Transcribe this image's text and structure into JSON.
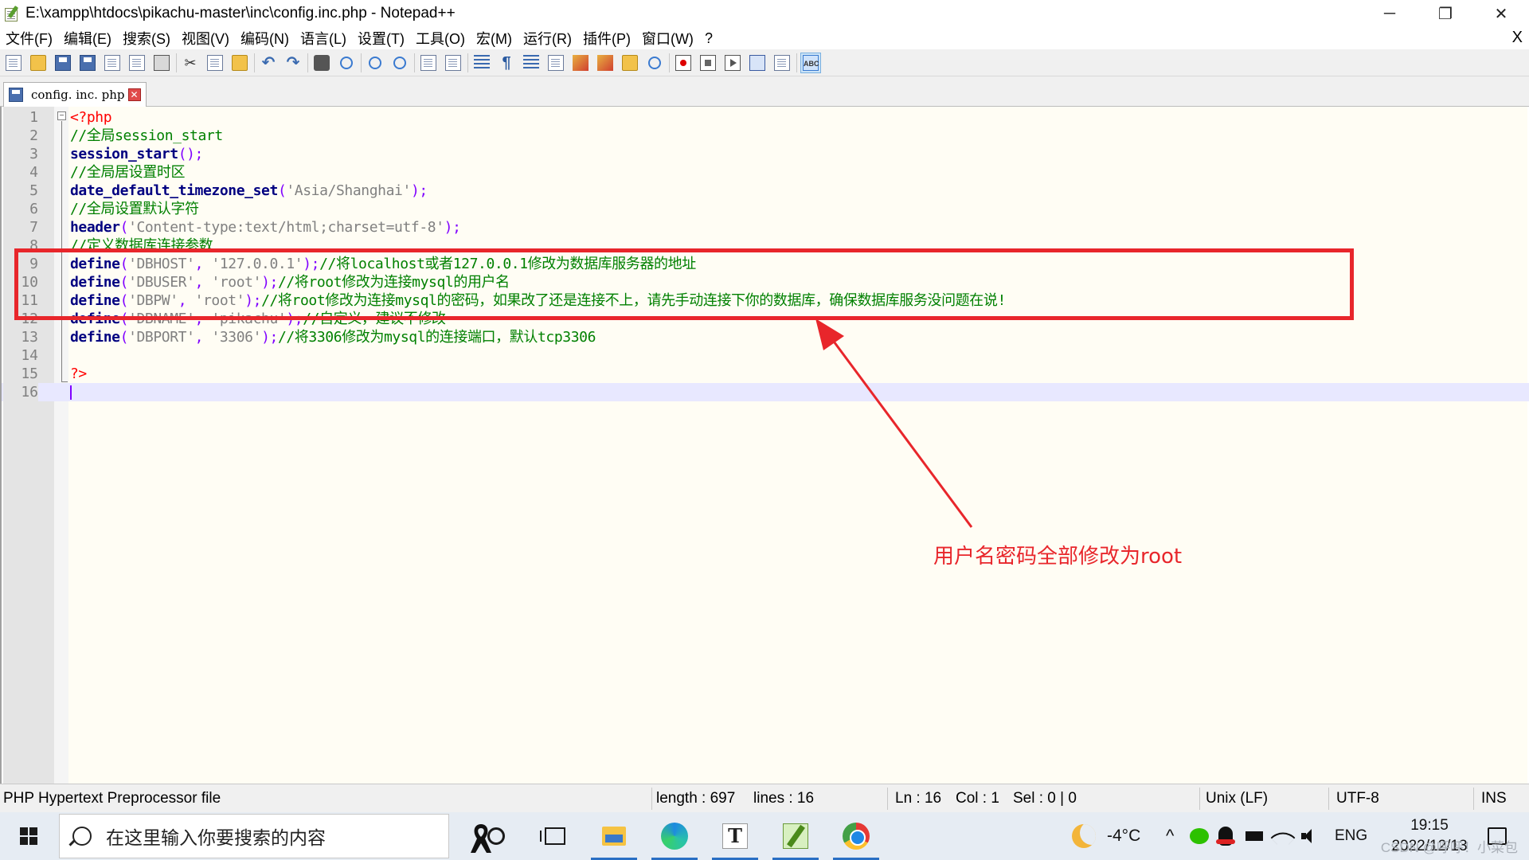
{
  "window": {
    "title": "E:\\xampp\\htdocs\\pikachu-master\\inc\\config.inc.php - Notepad++",
    "minimize": "─",
    "restore": "❐",
    "close": "✕"
  },
  "menu": {
    "items": [
      "文件(F)",
      "编辑(E)",
      "搜索(S)",
      "视图(V)",
      "编码(N)",
      "语言(L)",
      "设置(T)",
      "工具(O)",
      "宏(M)",
      "运行(R)",
      "插件(P)",
      "窗口(W)",
      "?"
    ],
    "close_doc": "X"
  },
  "toolbar": {
    "icons": [
      "new-file-icon",
      "open-file-icon",
      "save-icon",
      "save-all-icon",
      "close-icon",
      "close-all-icon",
      "print-icon",
      "cut-icon",
      "copy-icon",
      "paste-icon",
      "undo-icon",
      "redo-icon",
      "find-icon",
      "replace-icon",
      "zoom-in-icon",
      "zoom-out-icon",
      "sync-vertical-icon",
      "sync-horizontal-icon",
      "word-wrap-icon",
      "show-all-chars-icon",
      "indent-guide-icon",
      "doc-map-icon",
      "function-list-icon",
      "folder-workspace-icon",
      "monitor-icon",
      "record-macro-icon",
      "stop-macro-icon",
      "play-macro-icon",
      "run-macro-multiple-icon",
      "save-macro-icon",
      "spell-check-icon"
    ]
  },
  "tab": {
    "label": "config. inc. php",
    "close": "✕"
  },
  "editor": {
    "lines": [
      {
        "n": "1",
        "tokens": [
          [
            "php",
            "<?php"
          ]
        ]
      },
      {
        "n": "2",
        "tokens": [
          [
            "cm",
            "//全局session_start"
          ]
        ]
      },
      {
        "n": "3",
        "tokens": [
          [
            "kw",
            "session_start"
          ],
          [
            "p",
            "();"
          ]
        ]
      },
      {
        "n": "4",
        "tokens": [
          [
            "cm",
            "//全局居设置时区"
          ]
        ]
      },
      {
        "n": "5",
        "tokens": [
          [
            "kw",
            "date_default_timezone_set"
          ],
          [
            "p",
            "("
          ],
          [
            "s",
            "'Asia/Shanghai'"
          ],
          [
            "p",
            ");"
          ]
        ]
      },
      {
        "n": "6",
        "tokens": [
          [
            "cm",
            "//全局设置默认字符"
          ]
        ]
      },
      {
        "n": "7",
        "tokens": [
          [
            "kw",
            "header"
          ],
          [
            "p",
            "("
          ],
          [
            "s",
            "'Content-type:text/html;charset=utf-8'"
          ],
          [
            "p",
            ");"
          ]
        ]
      },
      {
        "n": "8",
        "tokens": [
          [
            "cm",
            "//定义数据库连接参数"
          ]
        ]
      },
      {
        "n": "9",
        "tokens": [
          [
            "kw",
            "define"
          ],
          [
            "p",
            "("
          ],
          [
            "s",
            "'DBHOST'"
          ],
          [
            "p",
            ", "
          ],
          [
            "s",
            "'127.0.0.1'"
          ],
          [
            "p",
            ");"
          ],
          [
            "cm",
            "//将localhost或者127.0.0.1修改为数据库服务器的地址"
          ]
        ]
      },
      {
        "n": "10",
        "tokens": [
          [
            "kw",
            "define"
          ],
          [
            "p",
            "("
          ],
          [
            "s",
            "'DBUSER'"
          ],
          [
            "p",
            ", "
          ],
          [
            "s",
            "'root'"
          ],
          [
            "p",
            ");"
          ],
          [
            "cm",
            "//将root修改为连接mysql的用户名"
          ]
        ]
      },
      {
        "n": "11",
        "tokens": [
          [
            "kw",
            "define"
          ],
          [
            "p",
            "("
          ],
          [
            "s",
            "'DBPW'"
          ],
          [
            "p",
            ", "
          ],
          [
            "s",
            "'root'"
          ],
          [
            "p",
            ");"
          ],
          [
            "cm",
            "//将root修改为连接mysql的密码，如果改了还是连接不上，请先手动连接下你的数据库，确保数据库服务没问题在说!"
          ]
        ]
      },
      {
        "n": "12",
        "tokens": [
          [
            "kw",
            "define"
          ],
          [
            "p",
            "("
          ],
          [
            "s",
            "'DBNAME'"
          ],
          [
            "p",
            ", "
          ],
          [
            "s",
            "'pikachu'"
          ],
          [
            "p",
            ");"
          ],
          [
            "cm",
            "//自定义，建议不修改"
          ]
        ]
      },
      {
        "n": "13",
        "tokens": [
          [
            "kw",
            "define"
          ],
          [
            "p",
            "("
          ],
          [
            "s",
            "'DBPORT'"
          ],
          [
            "p",
            ", "
          ],
          [
            "s",
            "'3306'"
          ],
          [
            "p",
            ");"
          ],
          [
            "cm",
            "//将3306修改为mysql的连接端口，默认tcp3306"
          ]
        ]
      },
      {
        "n": "14",
        "tokens": []
      },
      {
        "n": "15",
        "tokens": [
          [
            "php",
            "?>"
          ]
        ]
      },
      {
        "n": "16",
        "tokens": []
      }
    ],
    "current_line": 16
  },
  "annotation": {
    "text": "用户名密码全部修改为root",
    "color": "#e8262b"
  },
  "status": {
    "file_type": "PHP Hypertext Preprocessor file",
    "length": "length : 697",
    "lines": "lines : 16",
    "ln": "Ln : 16",
    "col": "Col : 1",
    "sel": "Sel : 0 | 0",
    "eol": "Unix (LF)",
    "encoding": "UTF-8",
    "mode": "INS"
  },
  "taskbar": {
    "search_placeholder": "在这里输入你要搜索的内容",
    "apps": [
      "cortana-icon",
      "task-view-icon",
      "file-explorer-icon",
      "edge-icon",
      "typora-icon",
      "notepadpp-icon",
      "chrome-icon"
    ],
    "typora_letter": "T",
    "weather": "-4°C",
    "chevron": "^",
    "language": "ENG",
    "time": "19:15",
    "date": "2022/12/13",
    "watermark": "CSDN @呼呼！小菜包"
  }
}
